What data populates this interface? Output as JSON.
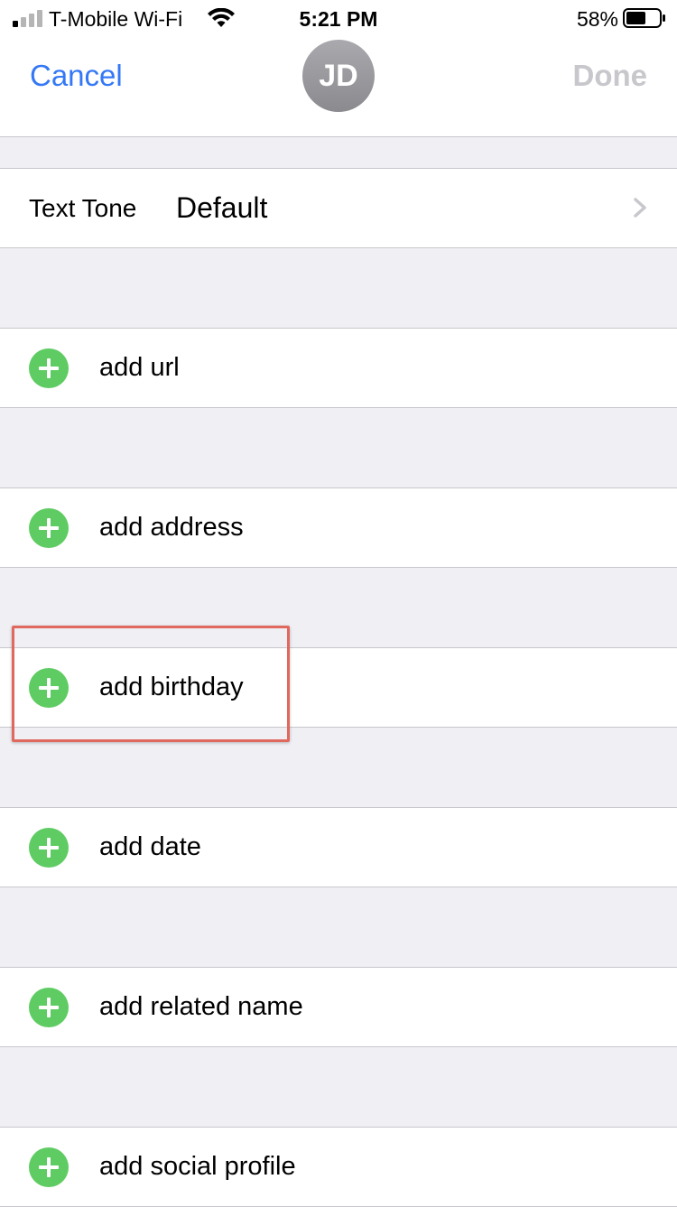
{
  "status_bar": {
    "carrier": "T-Mobile Wi-Fi",
    "time": "5:21 PM",
    "battery_percent": "58%",
    "icons": [
      "signal-icon",
      "wifi-icon",
      "battery-icon"
    ]
  },
  "nav": {
    "cancel_label": "Cancel",
    "done_label": "Done",
    "avatar_initials": "JD"
  },
  "text_tone": {
    "label": "Text Tone",
    "value": "Default",
    "icon": "chevron-right-icon"
  },
  "add_rows": [
    {
      "label": "add url",
      "icon": "plus-circle-icon"
    },
    {
      "label": "add address",
      "icon": "plus-circle-icon"
    },
    {
      "label": "add birthday",
      "icon": "plus-circle-icon",
      "highlighted": true
    },
    {
      "label": "add date",
      "icon": "plus-circle-icon"
    },
    {
      "label": "add related name",
      "icon": "plus-circle-icon"
    },
    {
      "label": "add social profile",
      "icon": "plus-circle-icon"
    }
  ],
  "colors": {
    "accent": "#3478f6",
    "add_green": "#5fcc63",
    "highlight": "#e0685e",
    "done_disabled": "#c7c7cc",
    "group_background": "#efeff4"
  }
}
